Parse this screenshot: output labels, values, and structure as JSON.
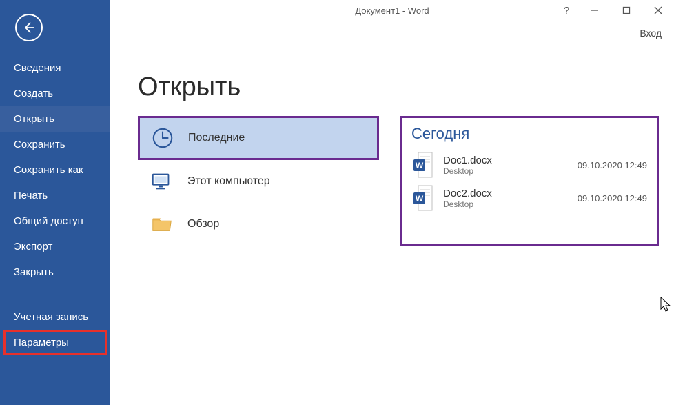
{
  "titlebar": {
    "title": "Документ1 - Word"
  },
  "signin_label": "Вход",
  "sidebar": {
    "items": [
      {
        "label": "Сведения"
      },
      {
        "label": "Создать"
      },
      {
        "label": "Открыть"
      },
      {
        "label": "Сохранить"
      },
      {
        "label": "Сохранить как"
      },
      {
        "label": "Печать"
      },
      {
        "label": "Общий доступ"
      },
      {
        "label": "Экспорт"
      },
      {
        "label": "Закрыть"
      }
    ],
    "account_label": "Учетная запись",
    "options_label": "Параметры"
  },
  "page": {
    "heading": "Открыть"
  },
  "sources": {
    "recent": "Последние",
    "thispc": "Этот компьютер",
    "browse": "Обзор"
  },
  "files": {
    "group_heading": "Сегодня",
    "items": [
      {
        "name": "Doc1.docx",
        "location": "Desktop",
        "date": "09.10.2020 12:49"
      },
      {
        "name": "Doc2.docx",
        "location": "Desktop",
        "date": "09.10.2020 12:49"
      }
    ]
  }
}
